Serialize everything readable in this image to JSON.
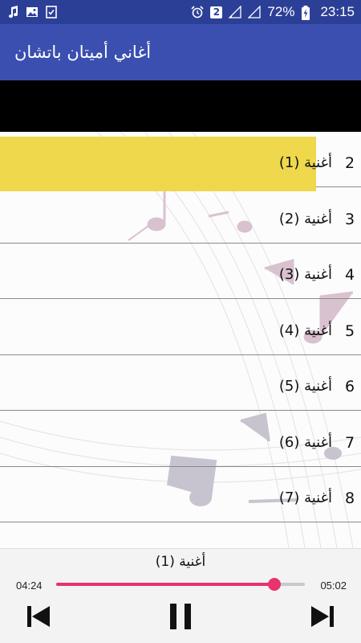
{
  "status_bar": {
    "left_icons": [
      "music-note-icon",
      "image-icon",
      "checklist-icon"
    ],
    "badge": "2",
    "battery": "72%",
    "time": "23:15"
  },
  "app_bar": {
    "title": "أغاني أميتان باتشان"
  },
  "songs": [
    {
      "number": "2",
      "title": "أغنية (1)",
      "active": true
    },
    {
      "number": "3",
      "title": "أغنية (2)",
      "active": false
    },
    {
      "number": "4",
      "title": "أغنية (3)",
      "active": false
    },
    {
      "number": "5",
      "title": "أغنية (4)",
      "active": false
    },
    {
      "number": "6",
      "title": "أغنية (5)",
      "active": false
    },
    {
      "number": "7",
      "title": "أغنية (6)",
      "active": false
    },
    {
      "number": "8",
      "title": "أغنية (7)",
      "active": false
    }
  ],
  "player": {
    "now_playing": "أغنية (1)",
    "current_time": "04:24",
    "duration": "05:02",
    "progress": 0.876
  },
  "colors": {
    "status_bar": "#2c3f97",
    "app_bar": "#3a4faf",
    "highlight": "#efd84b",
    "accent": "#e8336d"
  }
}
